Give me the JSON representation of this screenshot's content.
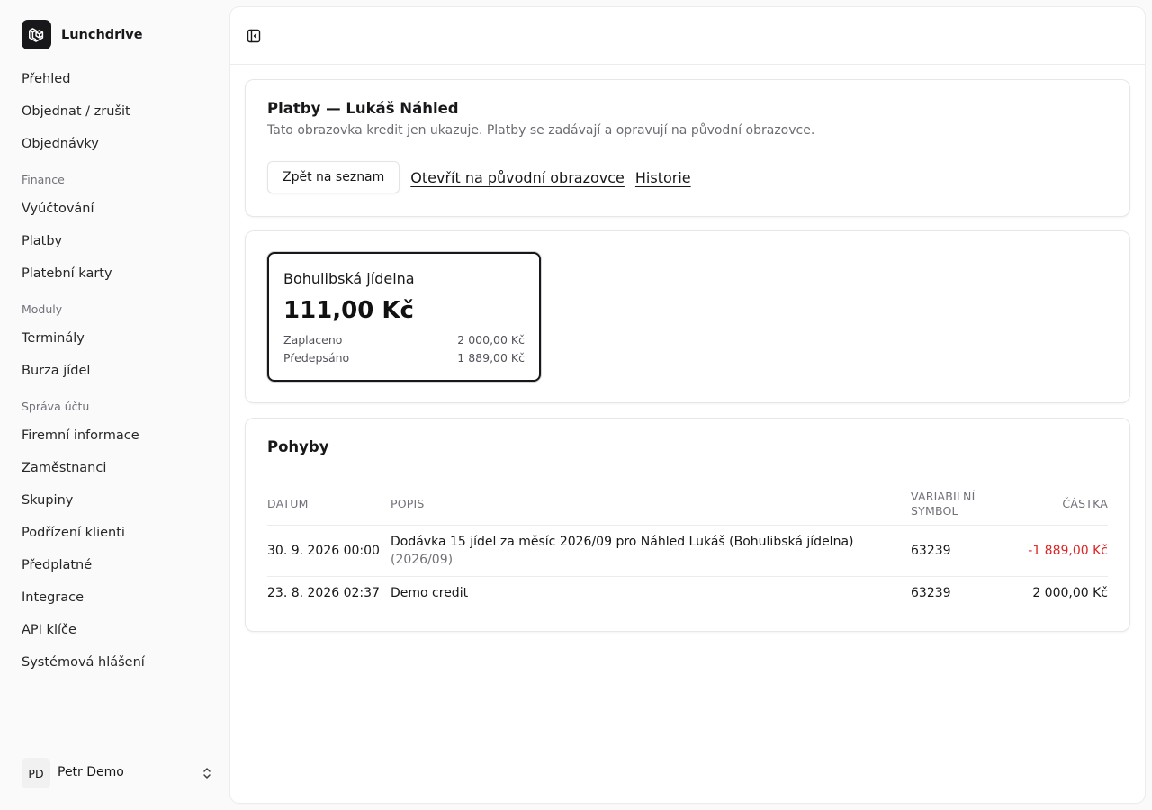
{
  "app": {
    "name": "Lunchdrive",
    "logo_icon": "laravel-cube-icon"
  },
  "sidebar": {
    "items": [
      {
        "type": "item",
        "label": "Přehled"
      },
      {
        "type": "item",
        "label": "Objednat / zrušit"
      },
      {
        "type": "item",
        "label": "Objednávky"
      },
      {
        "type": "group",
        "label": "Finance"
      },
      {
        "type": "item",
        "label": "Vyúčtování"
      },
      {
        "type": "item",
        "label": "Platby"
      },
      {
        "type": "item",
        "label": "Platební karty"
      },
      {
        "type": "group",
        "label": "Moduly"
      },
      {
        "type": "item",
        "label": "Terminály"
      },
      {
        "type": "item",
        "label": "Burza jídel"
      },
      {
        "type": "group",
        "label": "Správa účtu"
      },
      {
        "type": "item",
        "label": "Firemní informace"
      },
      {
        "type": "item",
        "label": "Zaměstnanci"
      },
      {
        "type": "item",
        "label": "Skupiny"
      },
      {
        "type": "item",
        "label": "Podřízení klienti"
      },
      {
        "type": "item",
        "label": "Předplatné"
      },
      {
        "type": "item",
        "label": "Integrace"
      },
      {
        "type": "item",
        "label": "API klíče"
      },
      {
        "type": "item",
        "label": "Systémová hlášení"
      }
    ],
    "user": {
      "initials": "PD",
      "name": "Petr Demo"
    }
  },
  "header": {
    "toggle_icon": "sidebar-collapse-icon"
  },
  "payments": {
    "title": "Platby — Lukáš Náhled",
    "subtitle": "Tato obrazovka kredit jen ukazuje. Platby se zadávají a opravují na původní obrazovce.",
    "back_label": "Zpět na seznam",
    "open_original_label": "Otevřít na původní obrazovce",
    "history_label": "Historie"
  },
  "canteen": {
    "name": "Bohulibská jídelna",
    "balance": "111,00 Kč",
    "paid_label": "Zaplaceno",
    "paid_value": "2 000,00 Kč",
    "prescribed_label": "Předepsáno",
    "prescribed_value": "1 889,00 Kč"
  },
  "movements": {
    "title": "Pohyby",
    "columns": {
      "date": "DATUM",
      "desc": "POPIS",
      "vs_line1": "VARIABILNÍ",
      "vs_line2": "SYMBOL",
      "amount": "ČÁSTKA"
    },
    "rows": [
      {
        "date": "30. 9. 2026 00:00",
        "desc": "Dodávka 15 jídel za měsíc 2026/09 pro Náhled Lukáš (Bohulibská jídelna)",
        "desc_sub": "(2026/09)",
        "vs": "63239",
        "amount": "-1 889,00 Kč"
      },
      {
        "date": "23. 8. 2026 02:37",
        "desc": "Demo credit",
        "vs": "63239",
        "amount": "2 000,00 Kč"
      }
    ]
  },
  "colors": {
    "accent": "#18181b",
    "negative": "#dc2626",
    "muted": "#71717a",
    "background": "#fafafa"
  }
}
